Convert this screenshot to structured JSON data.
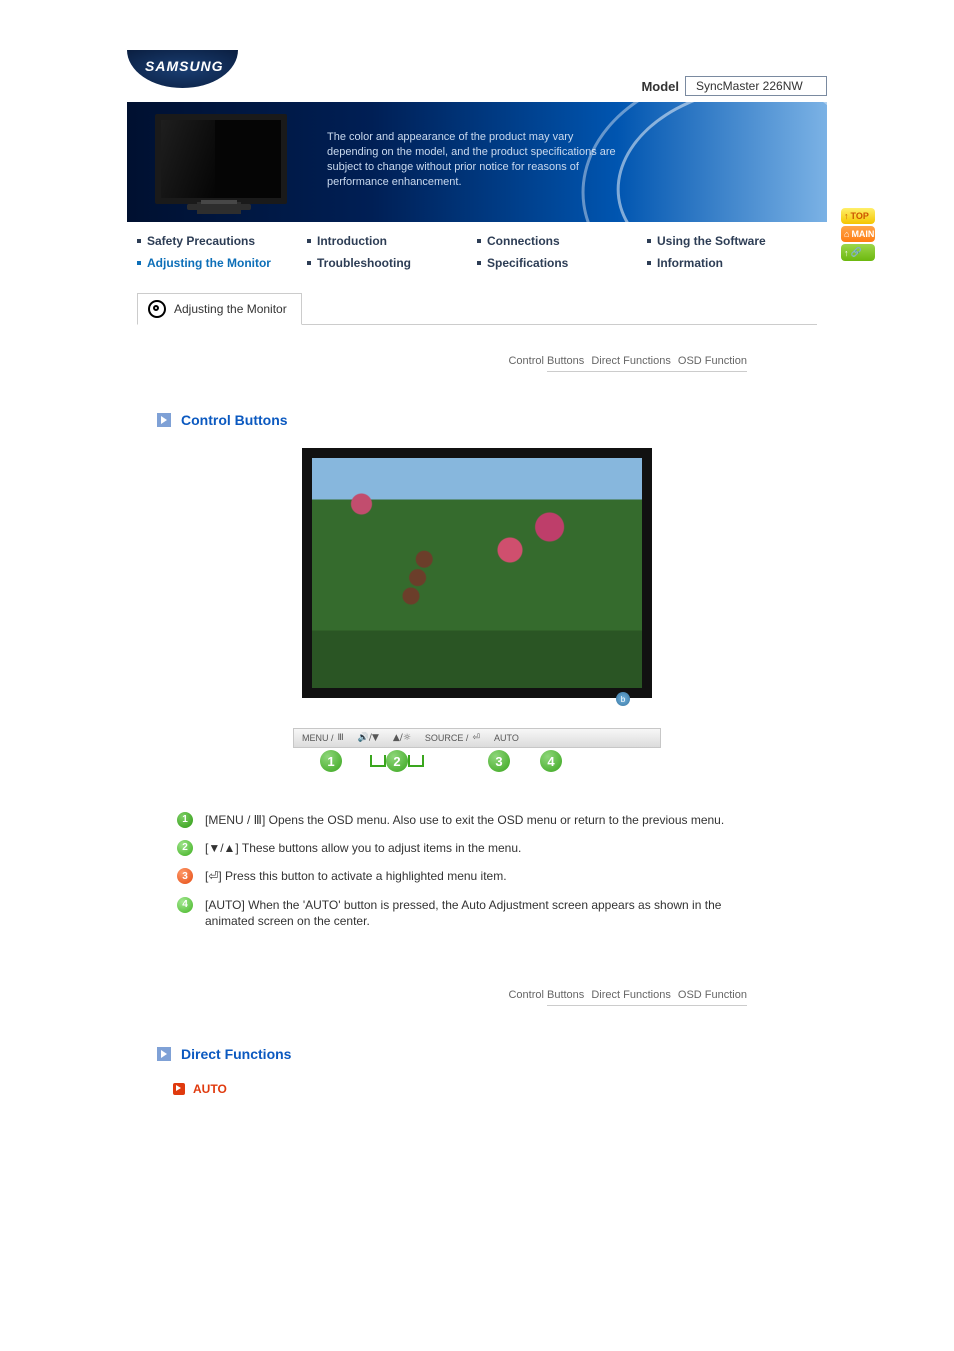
{
  "brand": "SAMSUNG",
  "model_label": "Model",
  "model_value": "SyncMaster 226NW",
  "disclaimer": "The color and appearance of the product may vary depending on the model, and the product specifications are subject to change without prior notice for reasons of performance enhancement.",
  "nav": {
    "safety": "Safety Precautions",
    "intro": "Introduction",
    "conn": "Connections",
    "software": "Using the Software",
    "adjust": "Adjusting the Monitor",
    "trouble": "Troubleshooting",
    "specs": "Specifications",
    "info": "Information"
  },
  "side_buttons": {
    "top": "TOP",
    "main": "MAIN"
  },
  "tab_title": "Adjusting the Monitor",
  "anchor_links": {
    "a1": "Control Buttons",
    "a2": "Direct Functions",
    "a3": "OSD Function"
  },
  "section1_title": "Control Buttons",
  "button_bar": {
    "menu": "MENU /",
    "source": "SOURCE /",
    "auto": "AUTO"
  },
  "led_label": "b",
  "descriptions": {
    "d1": "[MENU / Ⅲ] Opens the OSD menu. Also use to exit the OSD menu or return to the previous menu.",
    "d2": "[▼/▲] These buttons allow you to adjust items in the menu.",
    "d3": "[⏎] Press this button to activate a highlighted menu item.",
    "d4": "[AUTO] When the 'AUTO' button is pressed, the Auto Adjustment screen appears as shown in the animated screen on the center."
  },
  "section2_title": "Direct Functions",
  "subhead_auto": "AUTO",
  "ball_labels": {
    "b1": "1",
    "b2": "2",
    "b3": "3",
    "b4": "4"
  }
}
